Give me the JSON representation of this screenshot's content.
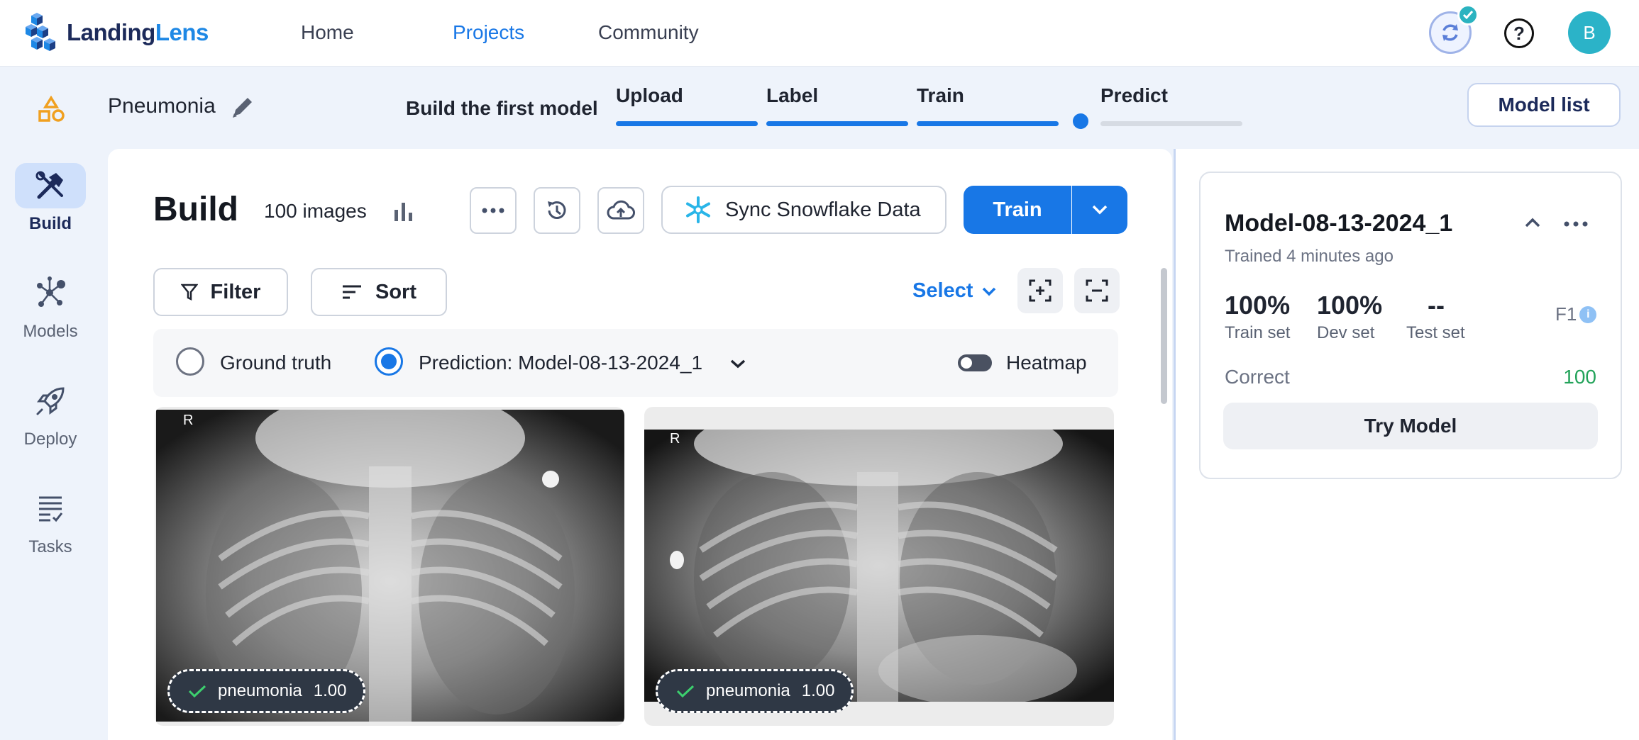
{
  "topnav": {
    "logo_text_a": "Landing",
    "logo_text_b": "Lens",
    "links": [
      "Home",
      "Projects",
      "Community"
    ],
    "active_link": "Projects",
    "avatar_initial": "B",
    "help_glyph": "?"
  },
  "project": {
    "name": "Pneumonia",
    "build_first_label": "Build the first model",
    "steps": [
      {
        "label": "Upload",
        "complete": true
      },
      {
        "label": "Label",
        "complete": true
      },
      {
        "label": "Train",
        "complete": true
      },
      {
        "label": "Predict",
        "complete": false
      }
    ],
    "model_list_label": "Model list"
  },
  "sidebar": {
    "items": [
      {
        "label": "Build",
        "icon": "build-tools-icon",
        "active": true
      },
      {
        "label": "Models",
        "icon": "models-network-icon",
        "active": false
      },
      {
        "label": "Deploy",
        "icon": "rocket-icon",
        "active": false
      },
      {
        "label": "Tasks",
        "icon": "tasks-list-icon",
        "active": false
      }
    ]
  },
  "build": {
    "title": "Build",
    "image_count": "100 images",
    "sync_label": "Sync Snowflake Data",
    "train_label": "Train",
    "filter_label": "Filter",
    "sort_label": "Sort",
    "select_label": "Select",
    "ground_truth_label": "Ground truth",
    "prediction_label": "Prediction: Model-08-13-2024_1",
    "heatmap_label": "Heatmap",
    "view_mode": "prediction",
    "heatmap_on": false
  },
  "images": [
    {
      "marker": "R",
      "label": "pneumonia",
      "score": "1.00"
    },
    {
      "marker": "R",
      "label": "pneumonia",
      "score": "1.00"
    }
  ],
  "model_card": {
    "name": "Model-08-13-2024_1",
    "trained": "Trained 4 minutes ago",
    "stats": [
      {
        "value": "100%",
        "label": "Train set"
      },
      {
        "value": "100%",
        "label": "Dev set"
      },
      {
        "value": "--",
        "label": "Test set"
      }
    ],
    "metric_label": "F1",
    "info_glyph": "i",
    "correct_label": "Correct",
    "correct_value": "100",
    "try_label": "Try Model"
  },
  "colors": {
    "accent": "#1877e6",
    "brand_dark": "#1c2a5a",
    "success": "#23a35a"
  }
}
